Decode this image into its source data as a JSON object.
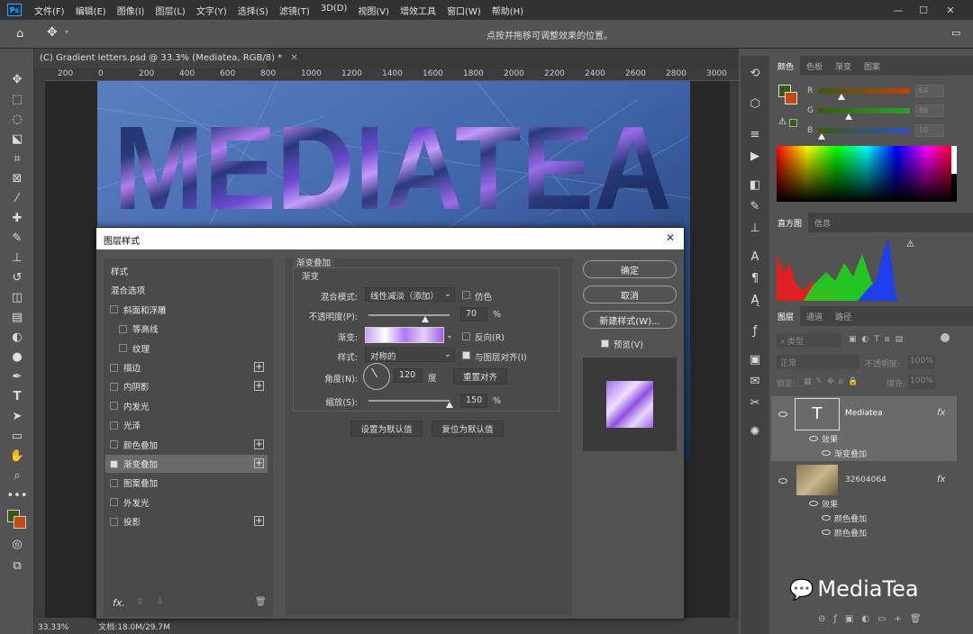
{
  "menu": {
    "items": [
      "文件(F)",
      "编辑(E)",
      "图像(I)",
      "图层(L)",
      "文字(Y)",
      "选择(S)",
      "滤镜(T)",
      "3D(D)",
      "视图(V)",
      "增效工具",
      "窗口(W)",
      "帮助(H)"
    ]
  },
  "options_bar": {
    "hint": "点按并拖移可调整效果的位置。"
  },
  "document": {
    "tab_title": "(C) Gradient letters.psd @ 33.3% (Mediatea, RGB/8) *",
    "canvas_text": "MEDIATEA",
    "ruler_x": [
      "200",
      "0",
      "200",
      "400",
      "600",
      "800",
      "1000",
      "1200",
      "1400",
      "1600",
      "1800",
      "2000",
      "2200",
      "2400",
      "2600",
      "2800",
      "3000"
    ],
    "zoom": "33.33%",
    "doc_info": "文档:18.0M/29.7M"
  },
  "color_panel": {
    "tabs": [
      "颜色",
      "色板",
      "渐变",
      "图案"
    ],
    "channels": [
      {
        "label": "R",
        "value": "64",
        "color": "#c04010"
      },
      {
        "label": "G",
        "value": "86",
        "color": "#30a030"
      },
      {
        "label": "B",
        "value": "10",
        "color": "#3050c0"
      }
    ],
    "foreground": "#3a5a12",
    "background": "#c04a12"
  },
  "histogram_panel": {
    "tabs": [
      "直方图",
      "信息"
    ]
  },
  "layers_panel": {
    "tabs": [
      "图层",
      "通道",
      "路径"
    ],
    "filter_label": "类型",
    "blend_mode": "正常",
    "opacity_label": "不透明度:",
    "opacity_value": "100%",
    "lock_label": "锁定:",
    "fill_label": "填充:",
    "fill_value": "100%",
    "layers": [
      {
        "name": "Mediatea",
        "effects_label": "效果",
        "effects": [
          "渐变叠加"
        ]
      },
      {
        "name": "32604064",
        "effects_label": "效果",
        "effects": [
          "颜色叠加",
          "颜色叠加"
        ]
      }
    ],
    "fx": "fx"
  },
  "watermark": "MediaTea",
  "dialog": {
    "title": "图层样式",
    "styles": [
      {
        "label": "样式",
        "check": false,
        "plus": false,
        "indent": false,
        "nocheck": true
      },
      {
        "label": "混合选项",
        "check": false,
        "plus": false,
        "indent": false,
        "nocheck": true
      },
      {
        "label": "斜面和浮雕",
        "check": false,
        "plus": false,
        "indent": false
      },
      {
        "label": "等高线",
        "check": false,
        "plus": false,
        "indent": true
      },
      {
        "label": "纹理",
        "check": false,
        "plus": false,
        "indent": true
      },
      {
        "label": "描边",
        "check": false,
        "plus": true,
        "indent": false
      },
      {
        "label": "内阴影",
        "check": false,
        "plus": true,
        "indent": false
      },
      {
        "label": "内发光",
        "check": false,
        "plus": false,
        "indent": false
      },
      {
        "label": "光泽",
        "check": false,
        "plus": false,
        "indent": false
      },
      {
        "label": "颜色叠加",
        "check": false,
        "plus": true,
        "indent": false
      },
      {
        "label": "渐变叠加",
        "check": true,
        "plus": true,
        "indent": false,
        "selected": true
      },
      {
        "label": "图案叠加",
        "check": false,
        "plus": false,
        "indent": false
      },
      {
        "label": "外发光",
        "check": false,
        "plus": false,
        "indent": false
      },
      {
        "label": "投影",
        "check": false,
        "plus": true,
        "indent": false
      }
    ],
    "section_title": "渐变叠加",
    "group_title": "渐变",
    "blend_label": "混合模式:",
    "blend_value": "线性减淡（添加）",
    "dither_label": "仿色",
    "opacity_label": "不透明度(P):",
    "opacity_value": "70",
    "opacity_fraction": 0.7,
    "percent": "%",
    "gradient_label": "渐变:",
    "reverse_label": "反向(R)",
    "style_label": "样式:",
    "style_value": "对称的",
    "align_label": "与图层对齐(I)",
    "angle_label": "角度(N):",
    "angle_value": "120",
    "degree": "度",
    "reset_align": "重置对齐",
    "scale_label": "缩放(S):",
    "scale_value": "150",
    "scale_fraction": 1.0,
    "set_default": "设置为默认值",
    "reset_default": "复位为默认值",
    "ok": "确定",
    "cancel": "取消",
    "new_style": "新建样式(W)...",
    "preview_label": "预览(V)",
    "fx": "fx."
  }
}
